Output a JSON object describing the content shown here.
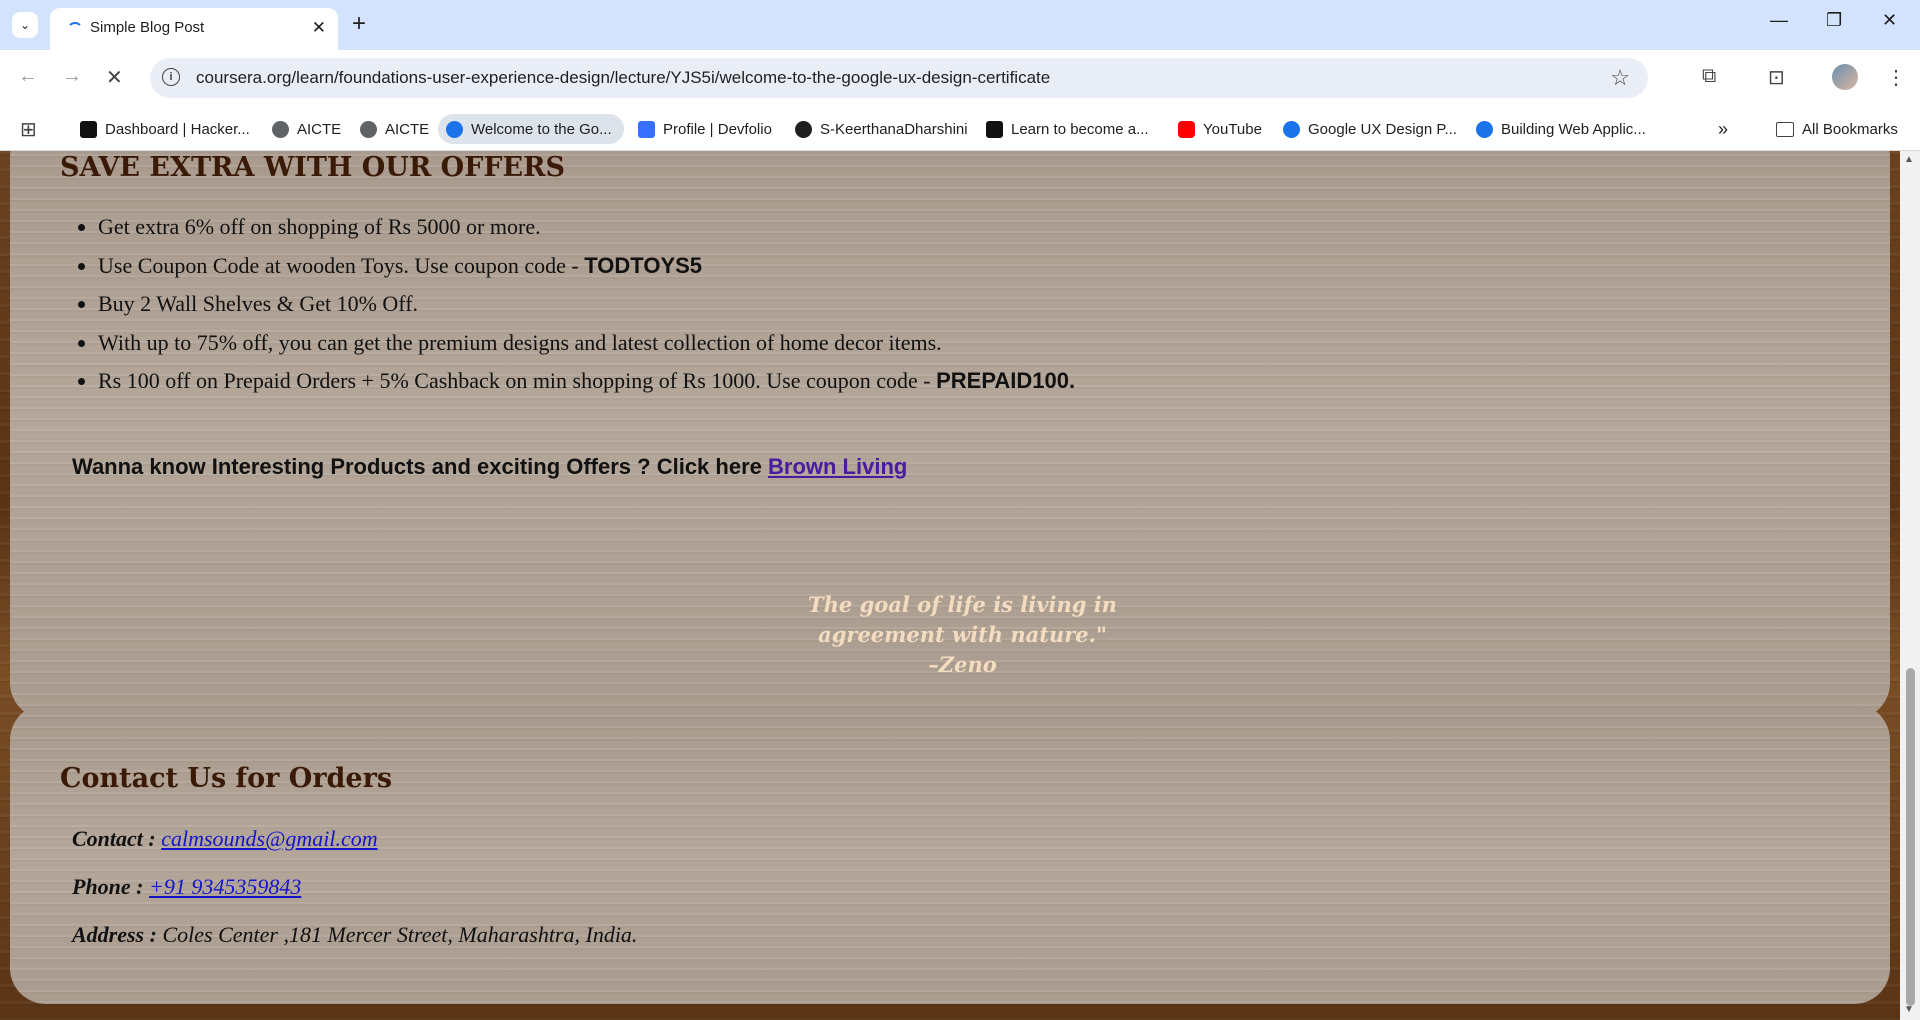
{
  "browser": {
    "tab_title": "Simple Blog Post",
    "url": "coursera.org/learn/foundations-user-experience-design/lecture/YJS5i/welcome-to-the-google-ux-design-certificate",
    "bookmarks": [
      {
        "label": "Dashboard | Hacker...",
        "icon": "hackerrank-icon",
        "color": "#111111"
      },
      {
        "label": "AICTE",
        "icon": "globe-icon",
        "color": "#5f6368"
      },
      {
        "label": "AICTE",
        "icon": "globe-icon",
        "color": "#5f6368"
      },
      {
        "label": "Welcome to the Go...",
        "icon": "coursera-icon",
        "color": "#1a73e8"
      },
      {
        "label": "Profile | Devfolio",
        "icon": "devfolio-icon",
        "color": "#3770ff"
      },
      {
        "label": "S-KeerthanaDharshini",
        "icon": "github-icon",
        "color": "#1f1f1f"
      },
      {
        "label": "Learn to become a...",
        "icon": "roadmap-icon",
        "color": "#111111"
      },
      {
        "label": "YouTube",
        "icon": "youtube-icon",
        "color": "#ff0000"
      },
      {
        "label": "Google UX Design P...",
        "icon": "coursera-icon",
        "color": "#1a73e8"
      },
      {
        "label": "Building Web Applic...",
        "icon": "coursera-icon",
        "color": "#1a73e8"
      }
    ],
    "all_bookmarks": "All Bookmarks"
  },
  "offers": {
    "heading": "SAVE EXTRA WITH OUR OFFERS",
    "items": [
      {
        "text": "Get extra 6% off on shopping of Rs 5000 or more.",
        "code": ""
      },
      {
        "text": "Use Coupon Code at wooden Toys. Use coupon code - ",
        "code": "TODTOYS5"
      },
      {
        "text": "Buy 2 Wall Shelves & Get 10% Off.",
        "code": ""
      },
      {
        "text": "With up to 75% off, you can get the premium designs and latest collection of home decor items.",
        "code": ""
      },
      {
        "text": "Rs 100 off on Prepaid Orders + 5% Cashback on min shopping of Rs 1000. Use coupon code - ",
        "code": "PREPAID100."
      }
    ],
    "cta_text": "Wanna know Interesting Products and exciting Offers ? Click here ",
    "cta_link": "Brown Living"
  },
  "quote": {
    "line1": "The goal of life is living in",
    "line2": "agreement with nature.\"",
    "author": "–Zeno"
  },
  "contact": {
    "heading": "Contact Us for Orders",
    "contact_label": "Contact :",
    "email": "calmsounds@gmail.com",
    "phone_label": "Phone :",
    "phone": "+91 9345359843",
    "address_label": "Address :",
    "address": "Coles Center ,181 Mercer Street, Maharashtra, India."
  }
}
